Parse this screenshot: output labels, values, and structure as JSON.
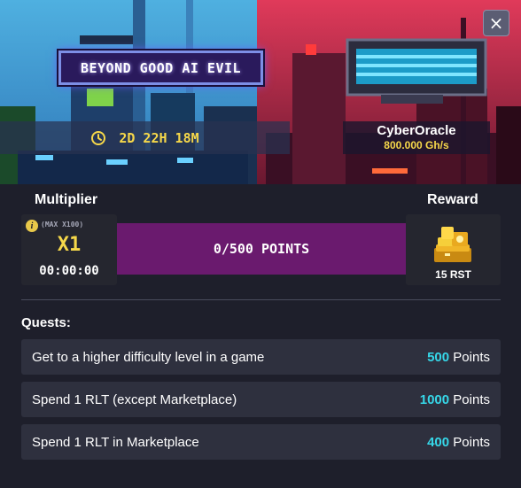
{
  "header": {
    "event_title": "BEYOND GOOD AI EVIL",
    "close_label": "×",
    "timer": "2D 22H 18M",
    "miner": {
      "name": "CyberOracle",
      "power": "800.000 Gh/s"
    }
  },
  "progress": {
    "multiplier_heading": "Multiplier",
    "reward_heading": "Reward",
    "max_note": "(MAX X100)",
    "multiplier_value": "X1",
    "multiplier_time": "00:00:00",
    "points_label": "0/500 POINTS",
    "points_current": 0,
    "points_target": 500,
    "reward_amount": "15 RST"
  },
  "quests": {
    "heading": "Quests:",
    "items": [
      {
        "title": "Get to a higher difficulty level in a game",
        "points": "500",
        "unit": "Points"
      },
      {
        "title": "Spend 1 RLT (except Marketplace)",
        "points": "1000",
        "unit": "Points"
      },
      {
        "title": "Spend 1 RLT in Marketplace",
        "points": "400",
        "unit": "Points"
      }
    ]
  },
  "colors": {
    "background": "#1e1f2b",
    "accent_yellow": "#f6d84a",
    "points_cyan": "#36d7e8",
    "progress_bar": "#6a1a6e"
  },
  "icons": [
    "close-icon",
    "clock-icon",
    "info-icon",
    "gold-coins-icon"
  ]
}
